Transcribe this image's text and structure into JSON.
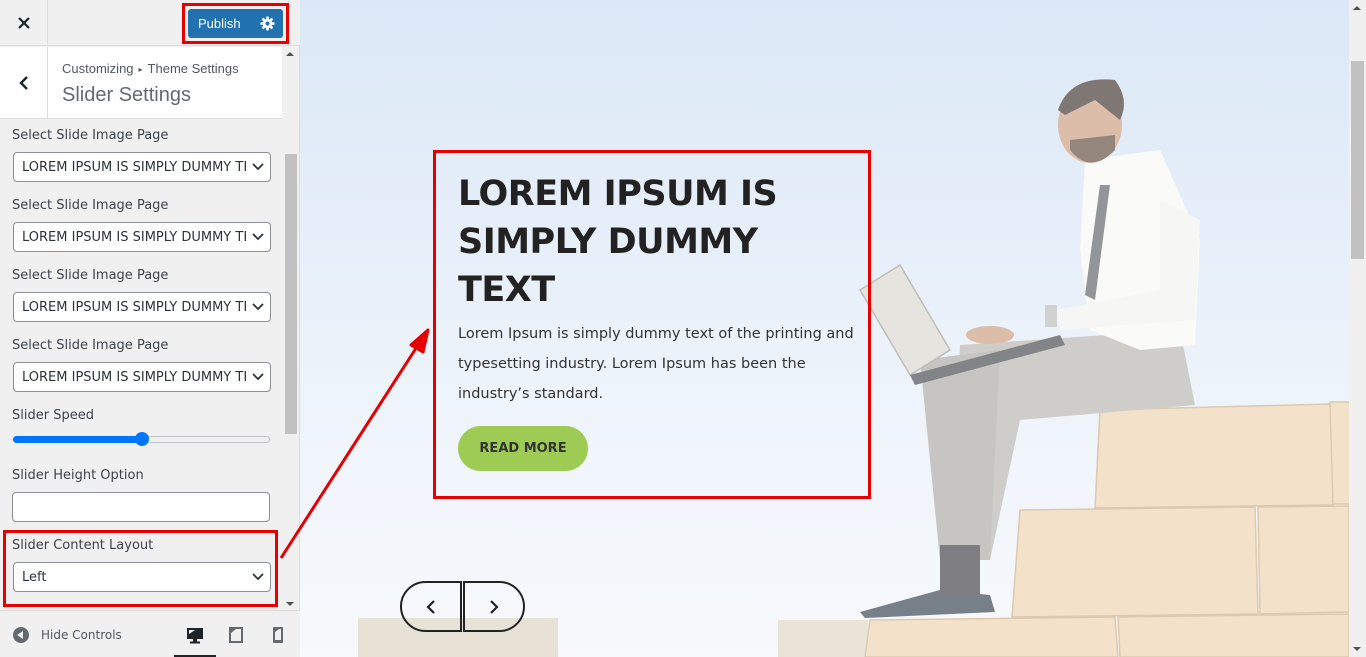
{
  "customizer": {
    "close_icon": "close-icon",
    "publish_label": "Publish",
    "publish_settings_icon": "gear-icon",
    "breadcrumb": {
      "root": "Customizing",
      "separator": "▸",
      "parent": "Theme Settings"
    },
    "section_title": "Slider Settings",
    "back_icon": "chevron-left-icon"
  },
  "controls": {
    "slide_pages": [
      {
        "label": "Select Slide Image Page",
        "value": "LOREM IPSUM IS SIMPLY DUMMY TEXT"
      },
      {
        "label": "Select Slide Image Page",
        "value": "LOREM IPSUM IS SIMPLY DUMMY TEXT"
      },
      {
        "label": "Select Slide Image Page",
        "value": "LOREM IPSUM IS SIMPLY DUMMY TEXT"
      },
      {
        "label": "Select Slide Image Page",
        "value": "LOREM IPSUM IS SIMPLY DUMMY TEXT"
      }
    ],
    "slider_speed": {
      "label": "Slider Speed",
      "value_fraction": 0.5
    },
    "slider_height": {
      "label": "Slider Height Option",
      "value": ""
    },
    "content_layout": {
      "label": "Slider Content Layout",
      "value": "Left"
    }
  },
  "footer": {
    "hide_controls_label": "Hide Controls",
    "devices": [
      {
        "name": "desktop",
        "icon": "desktop-icon",
        "active": true
      },
      {
        "name": "tablet",
        "icon": "tablet-icon",
        "active": false
      },
      {
        "name": "mobile",
        "icon": "mobile-icon",
        "active": false
      }
    ]
  },
  "preview": {
    "slide": {
      "title": "LOREM IPSUM IS SIMPLY DUMMY TEXT",
      "description": "Lorem Ipsum is simply dummy text of the printing and typesetting industry. Lorem Ipsum has been the industry’s standard.",
      "button_label": "READ MORE"
    },
    "nav": {
      "prev_icon": "chevron-left-icon",
      "next_icon": "chevron-right-icon"
    }
  },
  "colors": {
    "publish_blue": "#2271b1",
    "annotation_red": "#e60000",
    "button_green": "#9ecb53",
    "slider_blue": "#0075ff"
  }
}
